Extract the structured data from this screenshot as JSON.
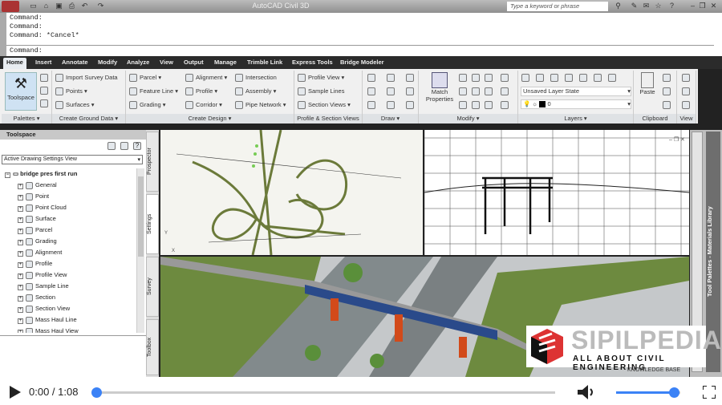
{
  "window": {
    "title": "AutoCAD Civil 3D",
    "search_placeholder": "Type a keyword or phrase"
  },
  "command": {
    "history": [
      "Command:",
      "Command:",
      "Command: *Cancel*"
    ],
    "prompt": "Command:"
  },
  "ribbon": {
    "tabs": [
      "Home",
      "Insert",
      "Annotate",
      "Modify",
      "Analyze",
      "View",
      "Output",
      "Manage",
      "Trimble Link",
      "Express Tools",
      "Bridge Modeler"
    ],
    "active_tab": "Home",
    "panels": {
      "palettes": {
        "label": "Palettes",
        "toolspace": "Toolspace"
      },
      "ground": {
        "label": "Create Ground Data",
        "items": [
          "Import Survey Data",
          "Points",
          "Surfaces"
        ]
      },
      "design": {
        "label": "Create Design",
        "items": [
          "Parcel",
          "Feature Line",
          "Grading",
          "Alignment",
          "Profile",
          "Corridor",
          "Intersection",
          "Assembly",
          "Pipe Network"
        ]
      },
      "profile": {
        "label": "Profile & Section Views",
        "items": [
          "Profile View",
          "Sample Lines",
          "Section Views"
        ]
      },
      "draw": {
        "label": "Draw"
      },
      "modify": {
        "label": "Modify",
        "match": "Match Properties"
      },
      "layers": {
        "label": "Layers",
        "state": "Unsaved Layer State",
        "layer": "0"
      },
      "clipboard": {
        "label": "Clipboard",
        "paste": "Paste"
      },
      "view": {
        "label": "View"
      }
    }
  },
  "toolspace": {
    "title": "Toolspace",
    "view": "Active Drawing Settings View",
    "root": "bridge pres first run",
    "items": [
      "General",
      "Point",
      "Point Cloud",
      "Surface",
      "Parcel",
      "Grading",
      "Alignment",
      "Profile",
      "Profile View",
      "Sample Line",
      "Section",
      "Section View",
      "Mass Haul Line",
      "Mass Haul View"
    ],
    "side_tabs": [
      "Prospector",
      "Settings",
      "Survey",
      "Toolbox"
    ]
  },
  "tool_palette": {
    "title": "Tool Palettes - Materials Library"
  },
  "watermark": {
    "brand": "SIPILPEDIA",
    "tagline": "ALL ABOUT CIVIL ENGINEERING",
    "footer": "KNOWLEDGE BASE"
  },
  "video": {
    "current": "0:00",
    "duration": "1:08",
    "time_sep": " / ",
    "progress": 0.0,
    "volume": 0.9,
    "accent": "#3b82f6"
  }
}
